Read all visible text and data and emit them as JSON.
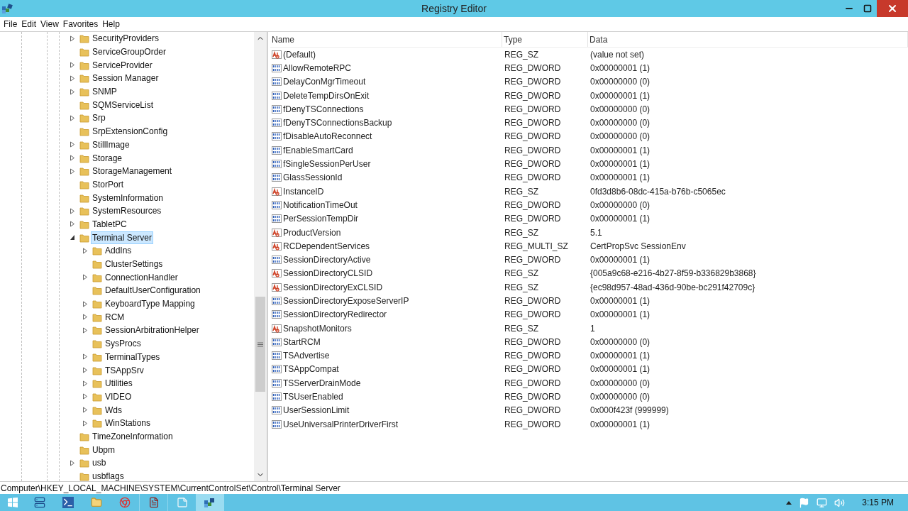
{
  "window": {
    "title": "Registry Editor"
  },
  "menu": [
    "File",
    "Edit",
    "View",
    "Favorites",
    "Help"
  ],
  "tree": [
    {
      "label": "SecurityProviders",
      "has_children": true,
      "expanded": false,
      "selected": false
    },
    {
      "label": "ServiceGroupOrder",
      "has_children": false,
      "selected": false
    },
    {
      "label": "ServiceProvider",
      "has_children": true,
      "expanded": false,
      "selected": false
    },
    {
      "label": "Session Manager",
      "has_children": true,
      "expanded": false,
      "selected": false
    },
    {
      "label": "SNMP",
      "has_children": true,
      "expanded": false,
      "selected": false
    },
    {
      "label": "SQMServiceList",
      "has_children": false,
      "selected": false
    },
    {
      "label": "Srp",
      "has_children": true,
      "expanded": false,
      "selected": false
    },
    {
      "label": "SrpExtensionConfig",
      "has_children": false,
      "selected": false
    },
    {
      "label": "StillImage",
      "has_children": true,
      "expanded": false,
      "selected": false
    },
    {
      "label": "Storage",
      "has_children": true,
      "expanded": false,
      "selected": false
    },
    {
      "label": "StorageManagement",
      "has_children": true,
      "expanded": false,
      "selected": false
    },
    {
      "label": "StorPort",
      "has_children": false,
      "selected": false
    },
    {
      "label": "SystemInformation",
      "has_children": false,
      "selected": false
    },
    {
      "label": "SystemResources",
      "has_children": true,
      "expanded": false,
      "selected": false
    },
    {
      "label": "TabletPC",
      "has_children": true,
      "expanded": false,
      "selected": false
    },
    {
      "label": "Terminal Server",
      "has_children": true,
      "expanded": true,
      "selected": true,
      "children": [
        {
          "label": "AddIns",
          "has_children": true,
          "expanded": false,
          "selected": false
        },
        {
          "label": "ClusterSettings",
          "has_children": false,
          "selected": false
        },
        {
          "label": "ConnectionHandler",
          "has_children": true,
          "expanded": false,
          "selected": false
        },
        {
          "label": "DefaultUserConfiguration",
          "has_children": false,
          "selected": false
        },
        {
          "label": "KeyboardType Mapping",
          "has_children": true,
          "expanded": false,
          "selected": false
        },
        {
          "label": "RCM",
          "has_children": true,
          "expanded": false,
          "selected": false
        },
        {
          "label": "SessionArbitrationHelper",
          "has_children": true,
          "expanded": false,
          "selected": false
        },
        {
          "label": "SysProcs",
          "has_children": false,
          "selected": false
        },
        {
          "label": "TerminalTypes",
          "has_children": true,
          "expanded": false,
          "selected": false
        },
        {
          "label": "TSAppSrv",
          "has_children": true,
          "expanded": false,
          "selected": false
        },
        {
          "label": "Utilities",
          "has_children": true,
          "expanded": false,
          "selected": false
        },
        {
          "label": "VIDEO",
          "has_children": true,
          "expanded": false,
          "selected": false
        },
        {
          "label": "Wds",
          "has_children": true,
          "expanded": false,
          "selected": false
        },
        {
          "label": "WinStations",
          "has_children": true,
          "expanded": false,
          "selected": false
        }
      ]
    },
    {
      "label": "TimeZoneInformation",
      "has_children": false,
      "selected": false
    },
    {
      "label": "Ubpm",
      "has_children": false,
      "selected": false
    },
    {
      "label": "usb",
      "has_children": true,
      "expanded": false,
      "selected": false
    },
    {
      "label": "usbflags",
      "has_children": false,
      "selected": false
    }
  ],
  "table": {
    "columns": [
      "Name",
      "Type",
      "Data"
    ],
    "rows": [
      {
        "kind": "string",
        "name": "(Default)",
        "type": "REG_SZ",
        "data": "(value not set)"
      },
      {
        "kind": "number",
        "name": "AllowRemoteRPC",
        "type": "REG_DWORD",
        "data": "0x00000001 (1)"
      },
      {
        "kind": "number",
        "name": "DelayConMgrTimeout",
        "type": "REG_DWORD",
        "data": "0x00000000 (0)"
      },
      {
        "kind": "number",
        "name": "DeleteTempDirsOnExit",
        "type": "REG_DWORD",
        "data": "0x00000001 (1)"
      },
      {
        "kind": "number",
        "name": "fDenyTSConnections",
        "type": "REG_DWORD",
        "data": "0x00000000 (0)"
      },
      {
        "kind": "number",
        "name": "fDenyTSConnectionsBackup",
        "type": "REG_DWORD",
        "data": "0x00000000 (0)"
      },
      {
        "kind": "number",
        "name": "fDisableAutoReconnect",
        "type": "REG_DWORD",
        "data": "0x00000000 (0)"
      },
      {
        "kind": "number",
        "name": "fEnableSmartCard",
        "type": "REG_DWORD",
        "data": "0x00000001 (1)"
      },
      {
        "kind": "number",
        "name": "fSingleSessionPerUser",
        "type": "REG_DWORD",
        "data": "0x00000001 (1)"
      },
      {
        "kind": "number",
        "name": "GlassSessionId",
        "type": "REG_DWORD",
        "data": "0x00000001 (1)"
      },
      {
        "kind": "string",
        "name": "InstanceID",
        "type": "REG_SZ",
        "data": "0fd3d8b6-08dc-415a-b76b-c5065ec"
      },
      {
        "kind": "number",
        "name": "NotificationTimeOut",
        "type": "REG_DWORD",
        "data": "0x00000000 (0)"
      },
      {
        "kind": "number",
        "name": "PerSessionTempDir",
        "type": "REG_DWORD",
        "data": "0x00000001 (1)"
      },
      {
        "kind": "string",
        "name": "ProductVersion",
        "type": "REG_SZ",
        "data": "5.1"
      },
      {
        "kind": "string",
        "name": "RCDependentServices",
        "type": "REG_MULTI_SZ",
        "data": "CertPropSvc SessionEnv"
      },
      {
        "kind": "number",
        "name": "SessionDirectoryActive",
        "type": "REG_DWORD",
        "data": "0x00000001 (1)"
      },
      {
        "kind": "string",
        "name": "SessionDirectoryCLSID",
        "type": "REG_SZ",
        "data": "{005a9c68-e216-4b27-8f59-b336829b3868}"
      },
      {
        "kind": "string",
        "name": "SessionDirectoryExCLSID",
        "type": "REG_SZ",
        "data": "{ec98d957-48ad-436d-90be-bc291f42709c}"
      },
      {
        "kind": "number",
        "name": "SessionDirectoryExposeServerIP",
        "type": "REG_DWORD",
        "data": "0x00000001 (1)"
      },
      {
        "kind": "number",
        "name": "SessionDirectoryRedirector",
        "type": "REG_DWORD",
        "data": "0x00000001 (1)"
      },
      {
        "kind": "string",
        "name": "SnapshotMonitors",
        "type": "REG_SZ",
        "data": "1"
      },
      {
        "kind": "number",
        "name": "StartRCM",
        "type": "REG_DWORD",
        "data": "0x00000000 (0)"
      },
      {
        "kind": "number",
        "name": "TSAdvertise",
        "type": "REG_DWORD",
        "data": "0x00000001 (1)"
      },
      {
        "kind": "number",
        "name": "TSAppCompat",
        "type": "REG_DWORD",
        "data": "0x00000001 (1)"
      },
      {
        "kind": "number",
        "name": "TSServerDrainMode",
        "type": "REG_DWORD",
        "data": "0x00000000 (0)"
      },
      {
        "kind": "number",
        "name": "TSUserEnabled",
        "type": "REG_DWORD",
        "data": "0x00000000 (0)"
      },
      {
        "kind": "number",
        "name": "UserSessionLimit",
        "type": "REG_DWORD",
        "data": "0x000f423f (999999)"
      },
      {
        "kind": "number",
        "name": "UseUniversalPrinterDriverFirst",
        "type": "REG_DWORD",
        "data": "0x00000001 (1)"
      }
    ]
  },
  "status_bar": "Computer\\HKEY_LOCAL_MACHINE\\SYSTEM\\CurrentControlSet\\Control\\Terminal Server",
  "taskbar": {
    "time": "3:15 PM"
  }
}
